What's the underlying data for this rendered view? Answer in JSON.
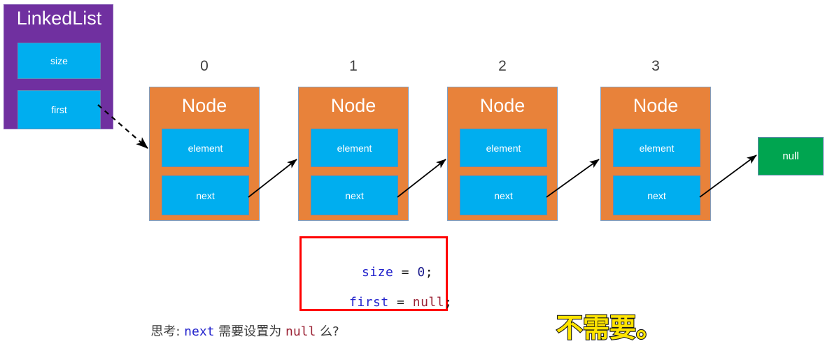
{
  "diagram": {
    "title": "LinkedList structure diagram",
    "colors": {
      "linkedlist_fill": "#7030A0",
      "node_fill": "#E8823A",
      "field_fill": "#00AEEF",
      "null_fill": "#00A550",
      "code_border": "#FF0000",
      "answer_text": "#FFE400",
      "index_text": "#3F3F3F"
    }
  },
  "linked_list": {
    "title": "LinkedList",
    "fields": [
      {
        "label": "size"
      },
      {
        "label": "first"
      }
    ]
  },
  "nodes": [
    {
      "index": "0",
      "title": "Node",
      "fields": [
        {
          "label": "element"
        },
        {
          "label": "next"
        }
      ]
    },
    {
      "index": "1",
      "title": "Node",
      "fields": [
        {
          "label": "element"
        },
        {
          "label": "next"
        }
      ]
    },
    {
      "index": "2",
      "title": "Node",
      "fields": [
        {
          "label": "element"
        },
        {
          "label": "next"
        }
      ]
    },
    {
      "index": "3",
      "title": "Node",
      "fields": [
        {
          "label": "element"
        },
        {
          "label": "next"
        }
      ]
    }
  ],
  "terminator": {
    "label": "null"
  },
  "code_block": {
    "lines": [
      {
        "tokens": [
          {
            "text": "size",
            "kind": "var"
          },
          {
            "text": " = ",
            "kind": "op"
          },
          {
            "text": "0",
            "kind": "num"
          },
          {
            "text": ";",
            "kind": "op"
          }
        ]
      },
      {
        "tokens": [
          {
            "text": "first",
            "kind": "var"
          },
          {
            "text": " = ",
            "kind": "op"
          },
          {
            "text": "null",
            "kind": "null"
          },
          {
            "text": ";",
            "kind": "op"
          }
        ]
      }
    ]
  },
  "caption": {
    "prefix": "思考: ",
    "code1": "next",
    "middle": " 需要设置为 ",
    "code2": "null",
    "suffix": " 么?"
  },
  "answer": {
    "text": "不需要。"
  }
}
